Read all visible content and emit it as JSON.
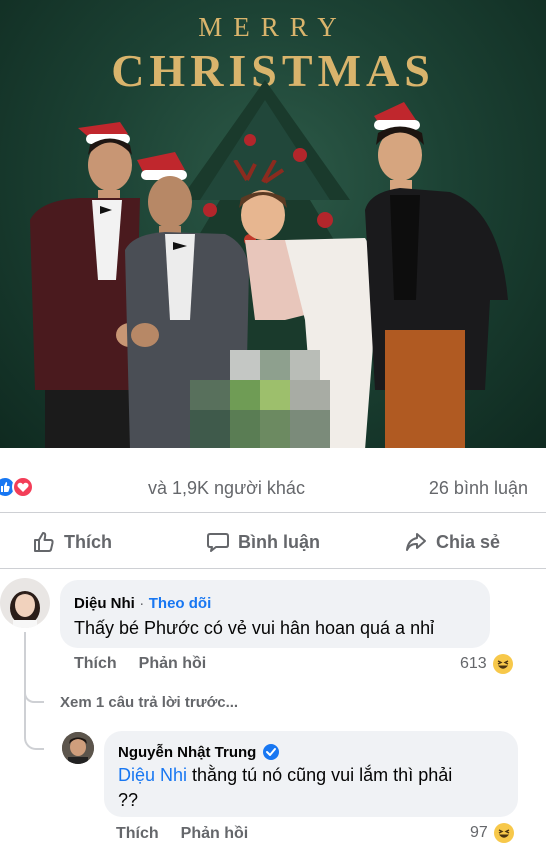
{
  "post_image": {
    "title_line1": "MERRY",
    "title_line2": "CHRISTMAS"
  },
  "reactions": {
    "summary": "và 1,9K người khác",
    "comments_count": "26 bình luận",
    "types": [
      "like",
      "love"
    ]
  },
  "actions": {
    "like": "Thích",
    "comment": "Bình luận",
    "share": "Chia sẻ"
  },
  "comments": [
    {
      "author": "Diệu Nhi",
      "separator": "·",
      "follow": "Theo dõi",
      "text": "Thấy bé Phước có vẻ vui hân hoan quá a nhỉ",
      "like_label": "Thích",
      "reply_label": "Phản hồi",
      "reaction_count": "613",
      "reaction_icon": "haha-icon"
    }
  ],
  "view_previous": "Xem 1 câu trả lời trước...",
  "replies": [
    {
      "author": "Nguyễn Nhật Trung",
      "verified": true,
      "mention": "Diệu Nhi",
      "text": "thằng tú nó cũng vui lắm thì phải",
      "text_line2": "??",
      "like_label": "Thích",
      "reply_label": "Phản hồi",
      "reaction_count": "97",
      "reaction_icon": "haha-icon"
    }
  ],
  "colors": {
    "accent": "#1877f2",
    "love": "#f33e58",
    "muted": "#65676b",
    "bubble": "#f0f2f5",
    "title_gold": "#d9b46c"
  }
}
